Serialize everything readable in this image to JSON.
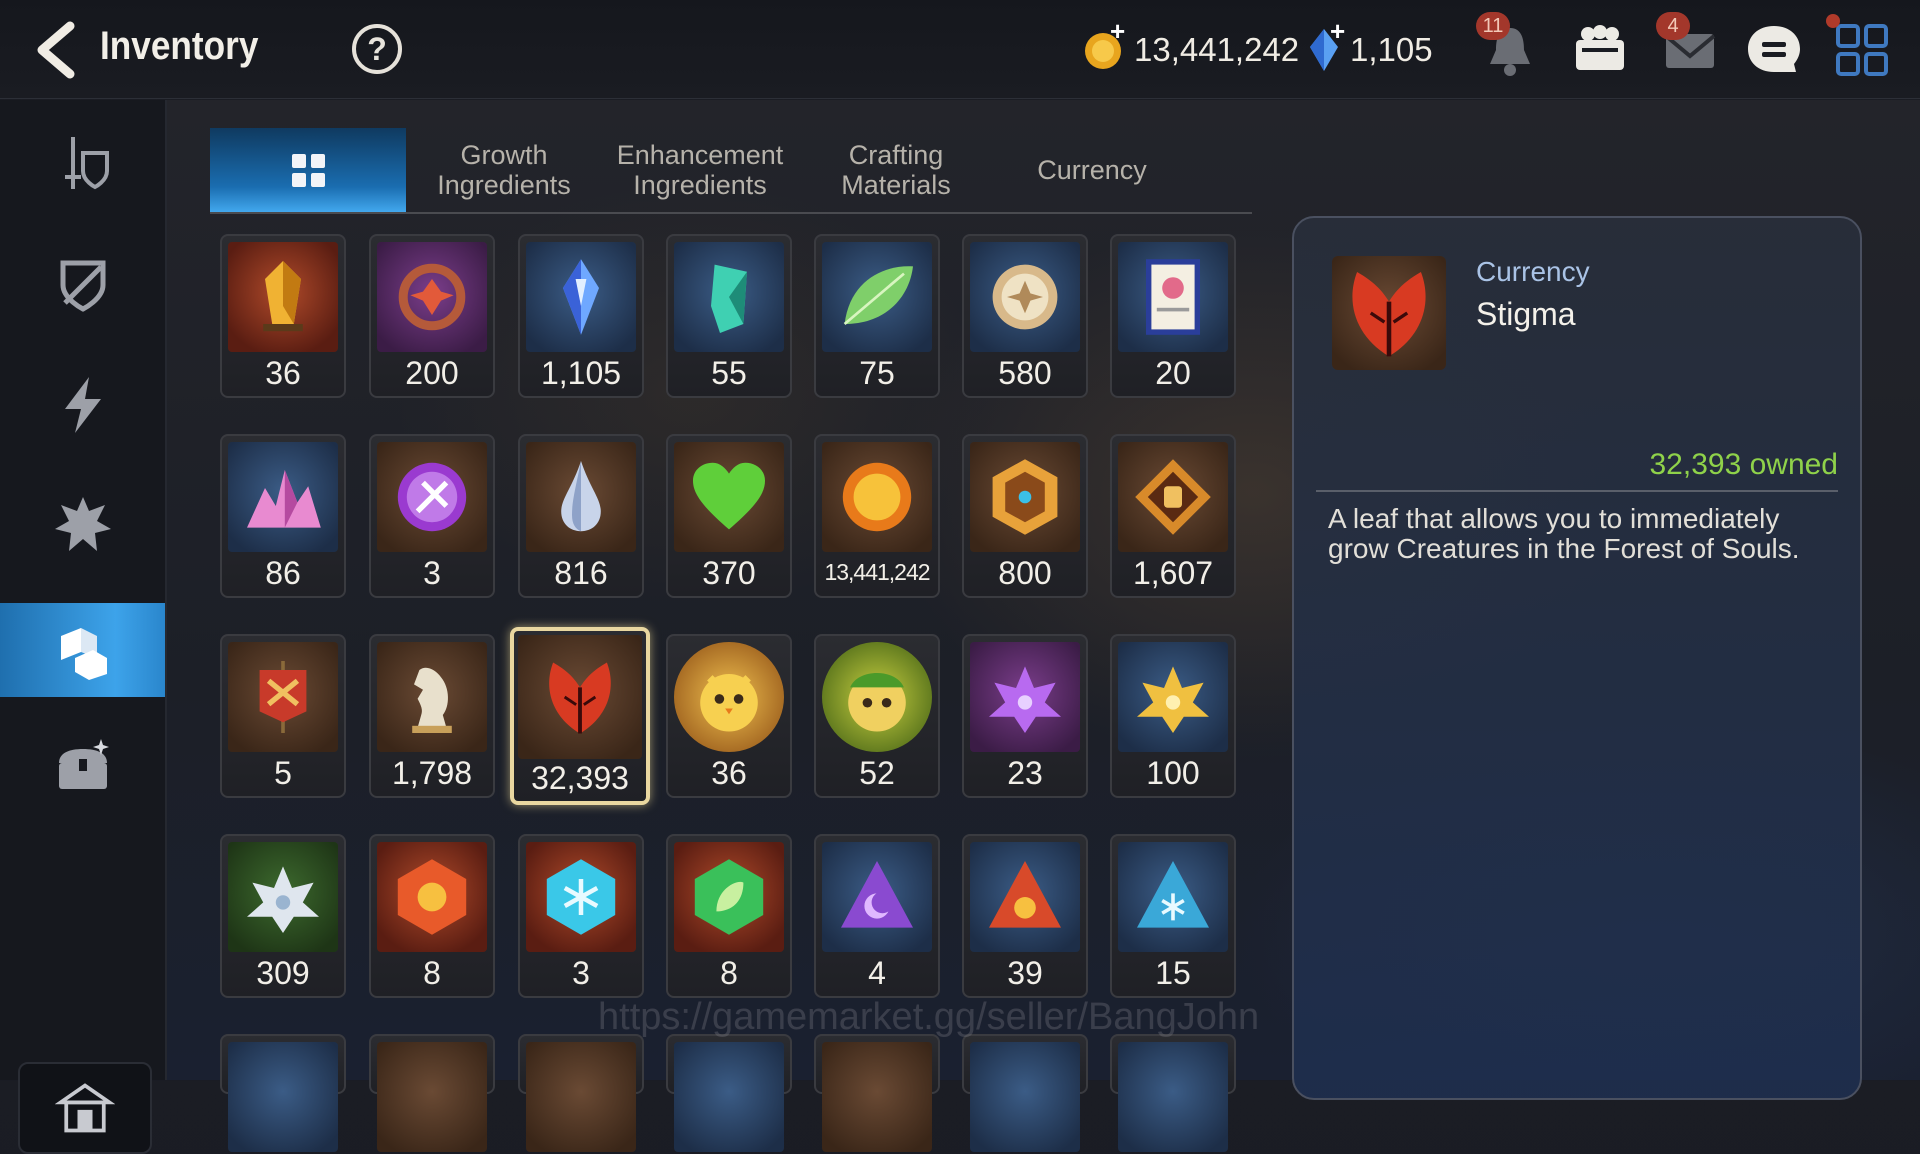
{
  "header": {
    "title": "Inventory",
    "help_label": "?",
    "gold": "13,441,242",
    "gems": "1,105",
    "notification_count": "11",
    "mail_count": "4"
  },
  "tabs": [
    {
      "label": "",
      "icon": "grid-icon",
      "active": true
    },
    {
      "label": "Growth\nIngredients"
    },
    {
      "label": "Enhancement\nIngredients"
    },
    {
      "label": "Crafting\nMaterials"
    },
    {
      "label": "Currency"
    }
  ],
  "items": [
    [
      "36",
      "200",
      "1,105",
      "55",
      "75",
      "580",
      "20"
    ],
    [
      "86",
      "3",
      "816",
      "370",
      "13,441,242",
      "800",
      "1,607"
    ],
    [
      "5",
      "1,798",
      "32,393",
      "36",
      "52",
      "23",
      "100"
    ],
    [
      "309",
      "8",
      "3",
      "8",
      "4",
      "39",
      "15"
    ]
  ],
  "detail": {
    "category": "Currency",
    "name": "Stigma",
    "owned": "32,393 owned",
    "description": "A leaf that allows you to immediately grow Creatures in the Forest of Souls."
  },
  "watermark": "https://gamemarket.gg/seller/BangJohn",
  "colors": {
    "accent": "#3da3ea",
    "owned": "#8fd24a",
    "badge": "#a3372b"
  }
}
